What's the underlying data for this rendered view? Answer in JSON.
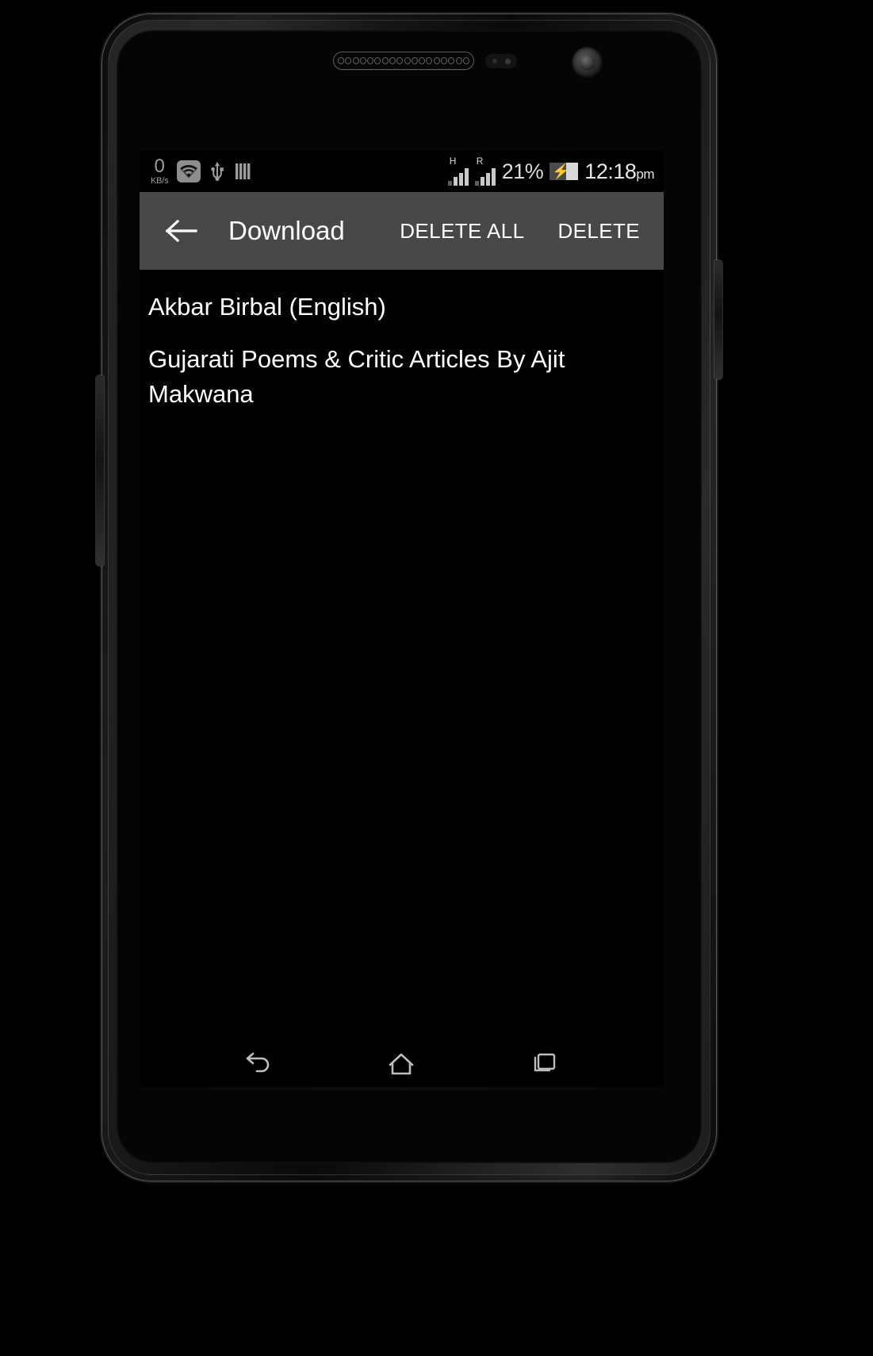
{
  "status_bar": {
    "net_speed_value": "0",
    "net_speed_unit": "KB/s",
    "wifi_icon": "wifi-icon",
    "usb_icon": "usb-icon",
    "sim_icon": "sim-card-icon",
    "signal_1_label": "H",
    "signal_2_label": "R",
    "battery_percent": "21%",
    "battery_icon": "battery-charging-icon",
    "time": "12:18",
    "am_pm": "pm"
  },
  "action_bar": {
    "back_icon": "back-arrow-icon",
    "title": "Download",
    "delete_all_label": "DELETE ALL",
    "delete_label": "DELETE",
    "background_color": "#484848",
    "text_color": "#ffffff"
  },
  "list": {
    "items": [
      {
        "title": "Akbar Birbal (English)"
      },
      {
        "title": "Gujarati Poems & Critic Articles By Ajit Makwana"
      }
    ]
  },
  "nav_bar": {
    "back_icon": "nav-back-icon",
    "home_icon": "nav-home-icon",
    "recents_icon": "nav-recents-icon"
  },
  "device": {
    "earpiece": "earpiece-grille",
    "proximity_sensor": "proximity-sensor",
    "front_camera": "front-camera",
    "volume_button": "volume-rocker",
    "power_button": "power-button"
  }
}
